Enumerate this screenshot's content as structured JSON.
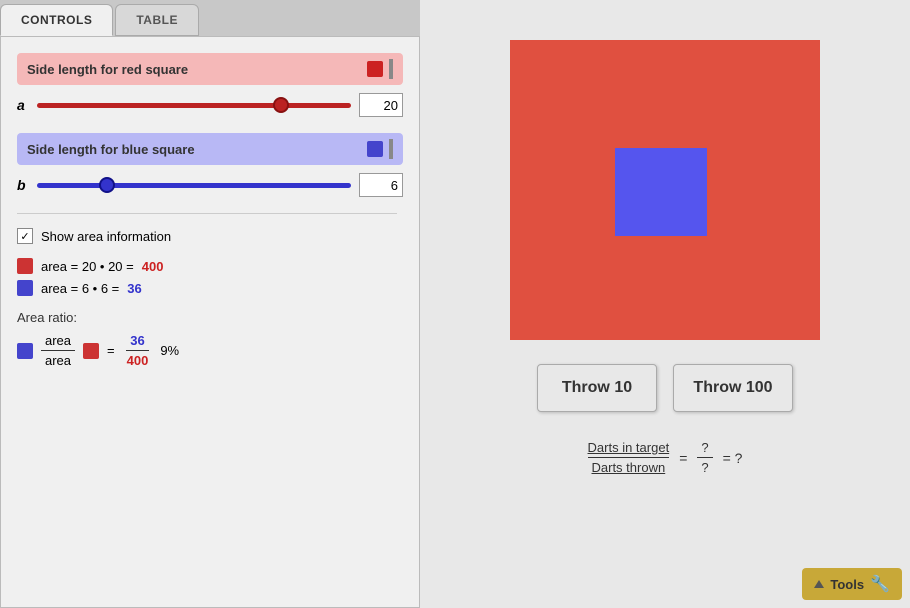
{
  "tabs": [
    {
      "label": "CONTROLS",
      "active": true
    },
    {
      "label": "TABLE",
      "active": false
    }
  ],
  "controls": {
    "red_slider": {
      "label": "Side length for red square",
      "var": "a",
      "value": 20,
      "min": 1,
      "max": 25
    },
    "blue_slider": {
      "label": "Side length for blue square",
      "var": "b",
      "value": 6,
      "min": 1,
      "max": 25
    },
    "checkbox": {
      "label": "Show area information",
      "checked": true
    },
    "area_info": {
      "red_area_expr": "area = 20 • 20 = ",
      "red_area_value": "400",
      "blue_area_expr": "area = 6 • 6 = ",
      "blue_area_value": "36"
    },
    "ratio": {
      "label": "Area ratio:",
      "numerator_label": "area",
      "denominator_label": "area",
      "numerator_value": "36",
      "denominator_value": "400",
      "percent": "9%"
    }
  },
  "canvas": {
    "throw10_label": "Throw 10",
    "throw100_label": "Throw 100",
    "darts_label_top": "Darts in target",
    "darts_label_bottom": "Darts thrown",
    "darts_numerator": "?",
    "darts_denominator": "?",
    "darts_result": "= ?"
  },
  "tools": {
    "label": "Tools"
  }
}
